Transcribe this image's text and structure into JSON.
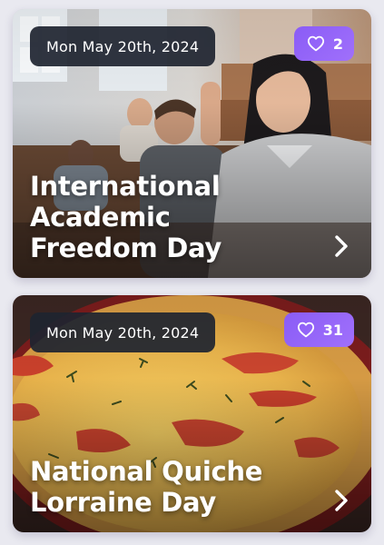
{
  "cards": [
    {
      "date": "Mon May 20th, 2024",
      "likes": "2",
      "title": "International Academic Freedom Day",
      "image": "lecture-hall-students-raising-hands",
      "like_icon": "heart-icon",
      "open_icon": "chevron-right-icon"
    },
    {
      "date": "Mon May 20th, 2024",
      "likes": "31",
      "title": "National Quiche Lorraine Day",
      "image": "quiche-with-tomatoes-in-dish",
      "like_icon": "heart-icon",
      "open_icon": "chevron-right-icon"
    }
  ],
  "colors": {
    "accent": "#8a5cf6",
    "date_pill": "#1e2430",
    "text": "#ffffff"
  }
}
